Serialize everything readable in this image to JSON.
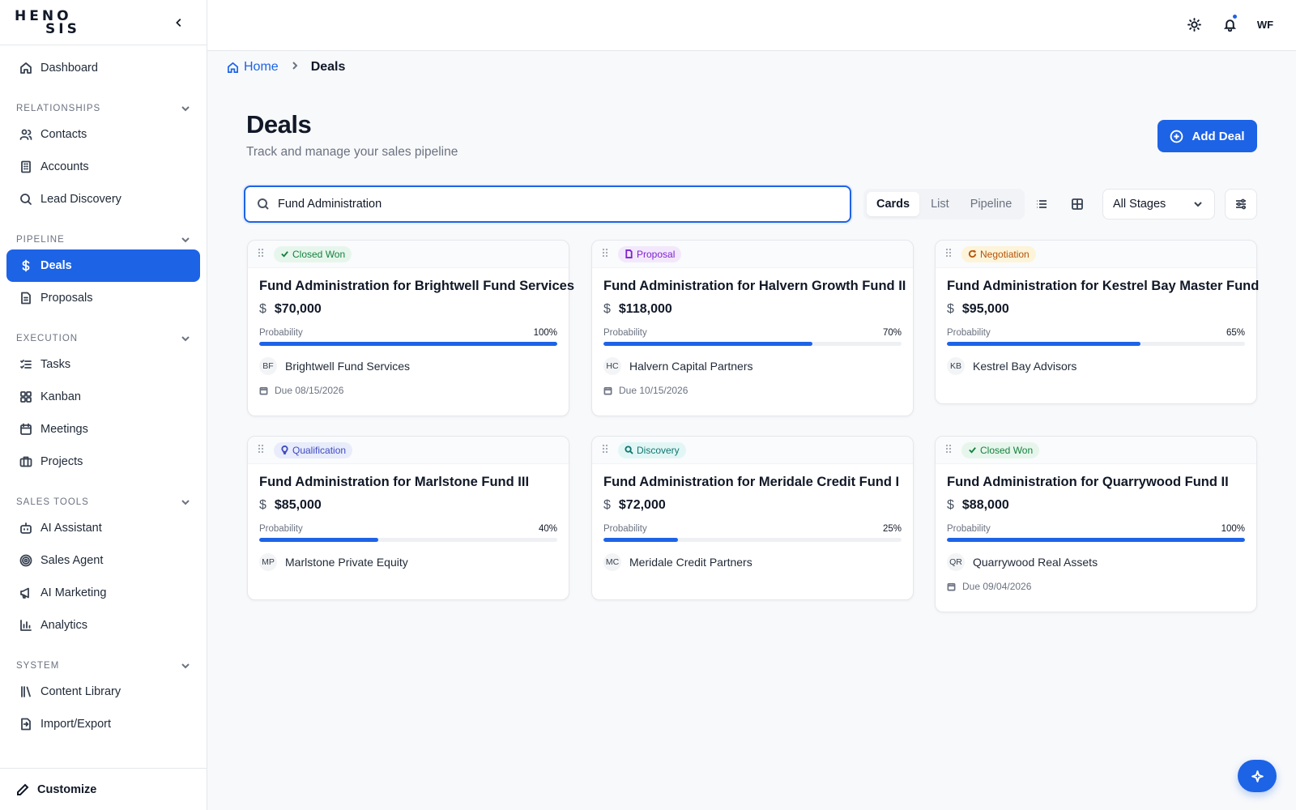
{
  "app": {
    "logo_line1": "HENO",
    "logo_line2": "SIS"
  },
  "sidebar": {
    "top_item": {
      "label": "Dashboard",
      "icon": "home-icon"
    },
    "sections": [
      {
        "title": "RELATIONSHIPS",
        "items": [
          {
            "label": "Contacts",
            "icon": "users-icon"
          },
          {
            "label": "Accounts",
            "icon": "building-icon"
          },
          {
            "label": "Lead Discovery",
            "icon": "search-icon"
          }
        ]
      },
      {
        "title": "PIPELINE",
        "items": [
          {
            "label": "Deals",
            "icon": "dollar-icon",
            "active": true
          },
          {
            "label": "Proposals",
            "icon": "document-icon"
          }
        ]
      },
      {
        "title": "EXECUTION",
        "items": [
          {
            "label": "Tasks",
            "icon": "list-check-icon"
          },
          {
            "label": "Kanban",
            "icon": "grid-icon"
          },
          {
            "label": "Meetings",
            "icon": "calendar-icon"
          },
          {
            "label": "Projects",
            "icon": "briefcase-icon"
          }
        ]
      },
      {
        "title": "SALES TOOLS",
        "items": [
          {
            "label": "AI Assistant",
            "icon": "bot-icon"
          },
          {
            "label": "Sales Agent",
            "icon": "target-icon"
          },
          {
            "label": "AI Marketing",
            "icon": "megaphone-icon"
          },
          {
            "label": "Analytics",
            "icon": "bar-chart-icon"
          }
        ]
      },
      {
        "title": "SYSTEM",
        "items": [
          {
            "label": "Content Library",
            "icon": "library-icon"
          },
          {
            "label": "Import/Export",
            "icon": "file-transfer-icon"
          }
        ]
      }
    ],
    "customize_label": "Customize"
  },
  "topbar": {
    "avatar_initials": "WF",
    "has_notification": true
  },
  "breadcrumb": {
    "home": "Home",
    "current": "Deals"
  },
  "header": {
    "title": "Deals",
    "subtitle": "Track and manage your sales pipeline",
    "add_button": "Add Deal"
  },
  "toolbar": {
    "search_value": "Fund Administration",
    "views": [
      "Cards",
      "List",
      "Pipeline"
    ],
    "active_view": "Cards",
    "stage_filter": "All Stages"
  },
  "colors": {
    "accent": "#1d63e6",
    "closed_won": "#15803d",
    "proposal": "#7e22ce",
    "negotiation": "#b45309",
    "qualification": "#3f4bbf",
    "discovery": "#0f766e"
  },
  "deals": [
    {
      "stage": "Closed Won",
      "stage_class": "b-won",
      "stage_icon": "check-icon",
      "title": "Fund Administration for Brightwell Fund Services",
      "amount": "$70,000",
      "probability_label": "Probability",
      "probability": 100,
      "probability_text": "100%",
      "initials": "BF",
      "company": "Brightwell Fund Services",
      "due": "Due 08/15/2026"
    },
    {
      "stage": "Proposal",
      "stage_class": "b-proposal",
      "stage_icon": "document-icon",
      "title": "Fund Administration for Halvern Growth Fund II",
      "amount": "$118,000",
      "probability_label": "Probability",
      "probability": 70,
      "probability_text": "70%",
      "initials": "HC",
      "company": "Halvern Capital Partners",
      "due": "Due 10/15/2026"
    },
    {
      "stage": "Negotiation",
      "stage_class": "b-negotiation",
      "stage_icon": "refresh-icon",
      "title": "Fund Administration for Kestrel Bay Master Fund",
      "amount": "$95,000",
      "probability_label": "Probability",
      "probability": 65,
      "probability_text": "65%",
      "initials": "KB",
      "company": "Kestrel Bay Advisors",
      "due": ""
    },
    {
      "stage": "Qualification",
      "stage_class": "b-qualification",
      "stage_icon": "lightbulb-icon",
      "title": "Fund Administration for Marlstone Fund III",
      "amount": "$85,000",
      "probability_label": "Probability",
      "probability": 40,
      "probability_text": "40%",
      "initials": "MP",
      "company": "Marlstone Private Equity",
      "due": ""
    },
    {
      "stage": "Discovery",
      "stage_class": "b-discovery",
      "stage_icon": "search-icon",
      "title": "Fund Administration for Meridale Credit Fund I",
      "amount": "$72,000",
      "probability_label": "Probability",
      "probability": 25,
      "probability_text": "25%",
      "initials": "MC",
      "company": "Meridale Credit Partners",
      "due": ""
    },
    {
      "stage": "Closed Won",
      "stage_class": "b-won",
      "stage_icon": "check-icon",
      "title": "Fund Administration for Quarrywood Fund II",
      "amount": "$88,000",
      "probability_label": "Probability",
      "probability": 100,
      "probability_text": "100%",
      "initials": "QR",
      "company": "Quarrywood Real Assets",
      "due": "Due 09/04/2026"
    }
  ]
}
